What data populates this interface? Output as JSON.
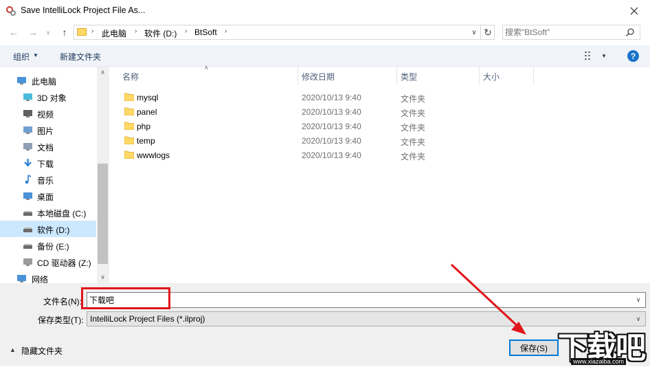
{
  "window": {
    "title": "Save IntelliLock Project File As..."
  },
  "address": {
    "crumbs": [
      "此电脑",
      "软件 (D:)",
      "BtSoft"
    ]
  },
  "search": {
    "placeholder": "搜索\"BtSoft\""
  },
  "toolbar": {
    "organize": "组织",
    "new_folder": "新建文件夹"
  },
  "nav": {
    "items": [
      {
        "label": "此电脑",
        "icon": "computer-icon",
        "root": true
      },
      {
        "label": "3D 对象",
        "icon": "3d-objects-icon"
      },
      {
        "label": "视频",
        "icon": "video-icon"
      },
      {
        "label": "图片",
        "icon": "pictures-icon"
      },
      {
        "label": "文档",
        "icon": "documents-icon"
      },
      {
        "label": "下载",
        "icon": "download-icon"
      },
      {
        "label": "音乐",
        "icon": "music-icon"
      },
      {
        "label": "桌面",
        "icon": "desktop-icon"
      },
      {
        "label": "本地磁盘 (C:)",
        "icon": "drive-icon"
      },
      {
        "label": "软件 (D:)",
        "icon": "drive-icon",
        "selected": true
      },
      {
        "label": "备份 (E:)",
        "icon": "drive-icon"
      },
      {
        "label": "CD 驱动器 (Z:)",
        "icon": "cd-drive-icon"
      },
      {
        "label": "网络",
        "icon": "network-icon",
        "root": true
      }
    ]
  },
  "columns": {
    "name": "名称",
    "date": "修改日期",
    "type": "类型",
    "size": "大小"
  },
  "files": [
    {
      "name": "mysql",
      "date": "2020/10/13 9:40",
      "type": "文件夹"
    },
    {
      "name": "panel",
      "date": "2020/10/13 9:40",
      "type": "文件夹"
    },
    {
      "name": "php",
      "date": "2020/10/13 9:40",
      "type": "文件夹"
    },
    {
      "name": "temp",
      "date": "2020/10/13 9:40",
      "type": "文件夹"
    },
    {
      "name": "wwwlogs",
      "date": "2020/10/13 9:40",
      "type": "文件夹"
    }
  ],
  "form": {
    "filename_label": "文件名(N):",
    "filename_value": "下载吧",
    "filetype_label": "保存类型(T):",
    "filetype_value": "IntelliLock  Project Files (*.ilproj)"
  },
  "footer": {
    "hide_folders": "隐藏文件夹",
    "save": "保存(S)"
  },
  "watermark": {
    "text": "下载吧",
    "url": "www.xiazaiba.com"
  },
  "colors": {
    "accent": "#0078d7",
    "selection": "#cce8ff",
    "annotation_red": "#e0141a",
    "folder": "#ffd865"
  }
}
